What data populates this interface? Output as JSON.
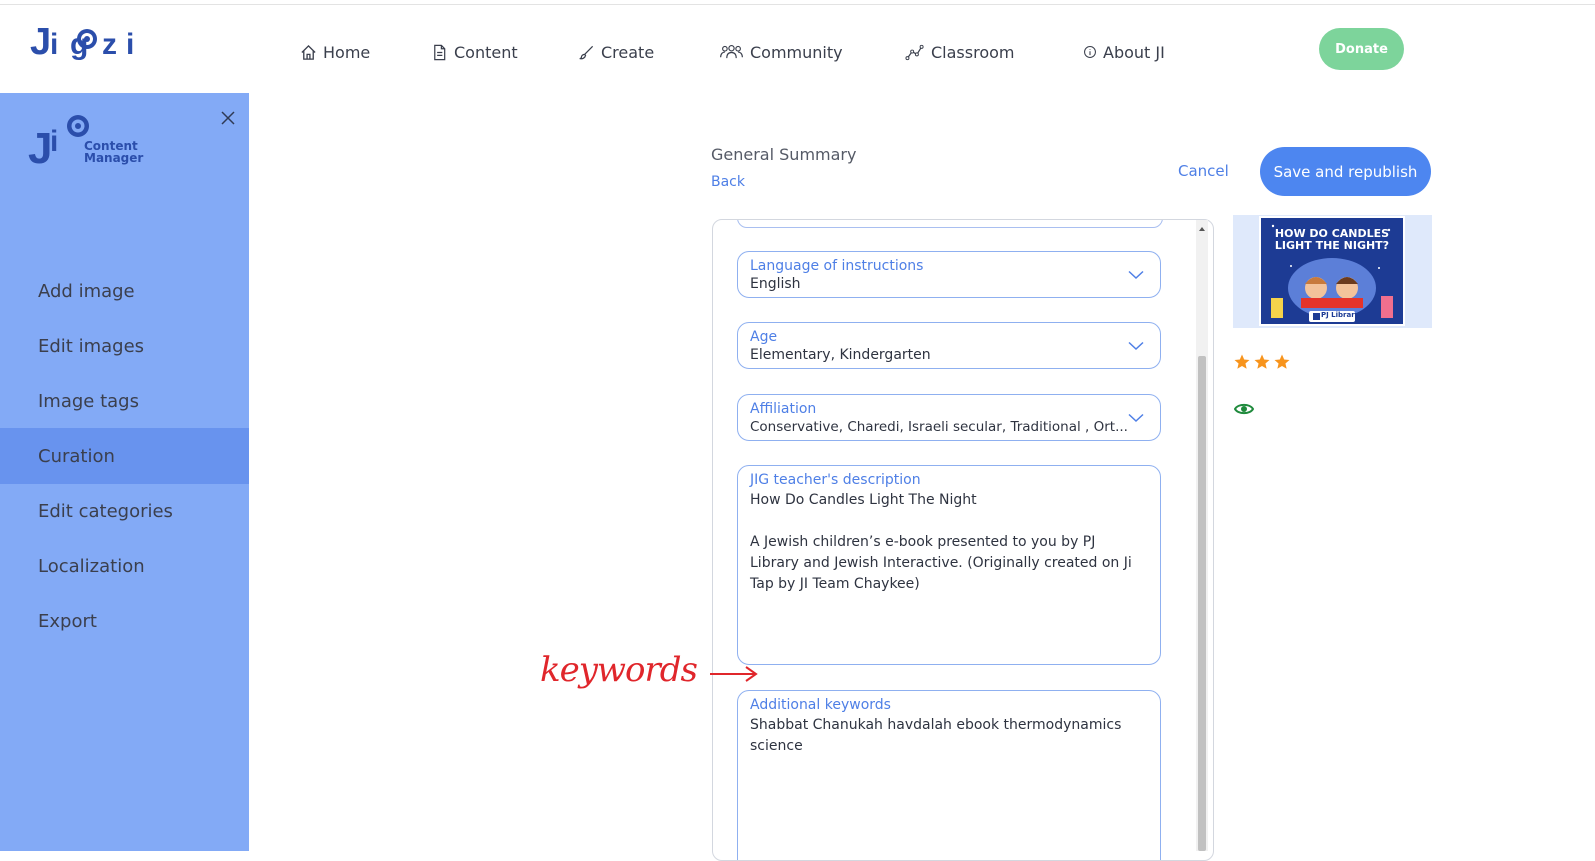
{
  "brand": {
    "logo_text": "Jigzi"
  },
  "nav": {
    "items": [
      {
        "label": "Home",
        "icon": "home-icon"
      },
      {
        "label": "Content",
        "icon": "document-icon"
      },
      {
        "label": "Create",
        "icon": "brush-icon"
      },
      {
        "label": "Community",
        "icon": "people-icon"
      },
      {
        "label": "Classroom",
        "icon": "chart-line-icon"
      },
      {
        "label": "About JI",
        "icon": "info-icon"
      }
    ],
    "donate_label": "Donate"
  },
  "sidebar": {
    "logo_line1": "Content",
    "logo_line2": "Manager",
    "items": [
      {
        "label": "Add image"
      },
      {
        "label": "Edit images"
      },
      {
        "label": "Image tags"
      },
      {
        "label": "Curation",
        "active": true
      },
      {
        "label": "Edit categories"
      },
      {
        "label": "Localization"
      },
      {
        "label": "Export"
      }
    ]
  },
  "header": {
    "title": "General Summary",
    "back_label": "Back",
    "cancel_label": "Cancel",
    "save_label": "Save and republish"
  },
  "form": {
    "language": {
      "label": "Language of instructions",
      "value": "English"
    },
    "age": {
      "label": "Age",
      "value": "Elementary, Kindergarten"
    },
    "affiliation": {
      "label": "Affiliation",
      "value": "Conservative, Charedi, Israeli secular, Traditional , Ort..."
    },
    "description": {
      "label": "JIG teacher's description",
      "value": "How Do Candles Light The Night\n\nA Jewish children’s e-book presented to you by PJ Library and Jewish Interactive. (Originally created on Ji Tap by JI Team Chaykee)"
    },
    "keywords": {
      "label": "Additional keywords",
      "value": "Shabbat Chanukah havdalah ebook thermodynamics science"
    }
  },
  "preview": {
    "thumbnail_title": "HOW DO CANDLES LIGHT THE NIGHT?",
    "thumbnail_publisher": "PJ Library",
    "rating": 3,
    "star_color": "#f7941d",
    "eye_color": "#1f8a3c"
  },
  "annotation": {
    "text": "keywords",
    "color": "#e0262b"
  },
  "colors": {
    "accent": "#4d86f0",
    "sidebar": "#83aaf6",
    "sidebar_active": "#6893ee",
    "donate": "#7dd49b"
  }
}
